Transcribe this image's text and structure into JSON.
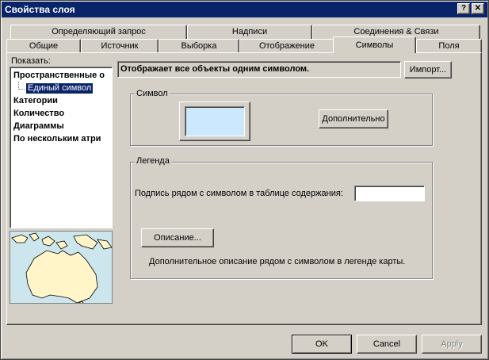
{
  "window": {
    "title": "Свойства слоя",
    "help_label": "?",
    "close_label": "✕"
  },
  "tabs_back": [
    "Определяющий запрос",
    "Надписи",
    "Соединения & Связи"
  ],
  "tabs_front": [
    "Общие",
    "Источник",
    "Выборка",
    "Отображение",
    "Символы",
    "Поля"
  ],
  "active_tab": "Символы",
  "show": {
    "label": "Показать:",
    "items": [
      "Пространственные о",
      "Единый символ",
      "Категории",
      "Количество",
      "Диаграммы",
      "По нескольким атри"
    ]
  },
  "main": {
    "description": "Отображает все объекты одним символом.",
    "import_label": "Импорт...",
    "symbol_group": "Символ",
    "symbol_color": "#cce8ff",
    "advanced_label": "Дополнительно",
    "legend_group": "Легенда",
    "legend_caption_label": "Подпись рядом с символом в таблице содержания:",
    "legend_caption_value": "",
    "description_button": "Описание...",
    "description_hint": "Дополнительное описание рядом с символом в легенде карты."
  },
  "footer": {
    "ok_label": "OK",
    "cancel_label": "Cancel",
    "apply_label": "Apply"
  }
}
